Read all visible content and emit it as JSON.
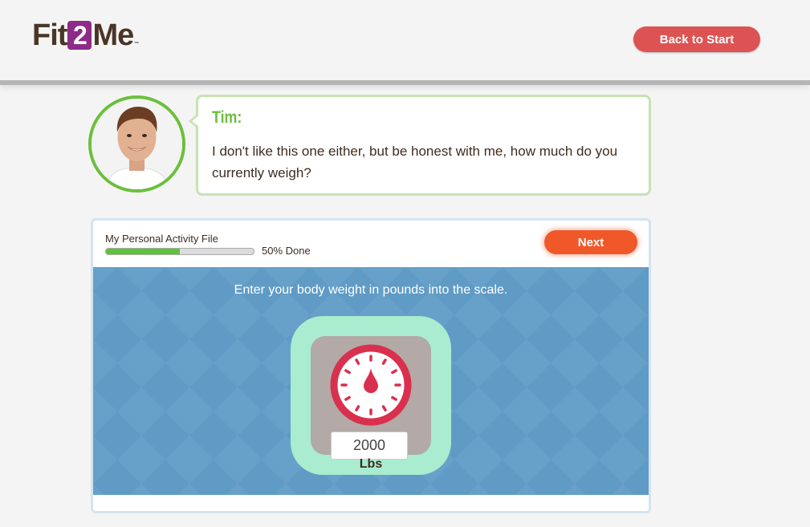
{
  "header": {
    "logo": {
      "part1": "Fit",
      "part2": "2",
      "part3": "Me",
      "tm": "™"
    },
    "back_button": "Back to Start"
  },
  "dialog": {
    "speaker": "Tim:",
    "message": "I don't like this one either, but be honest with me, how much do you currently weigh?"
  },
  "progress": {
    "label": "My Personal Activity File",
    "percent": 50,
    "text": "50% Done"
  },
  "next_button": "Next",
  "scale": {
    "instruction": "Enter your body weight in pounds into the scale.",
    "value": "2000",
    "unit": "Lbs"
  },
  "colors": {
    "brand_purple": "#8e2b88",
    "back_button": "#dd5353",
    "next_button": "#f0582a",
    "progress_fill": "#5ec33a",
    "avatar_ring": "#6bbf3b",
    "stage_blue": "#5f9bc5",
    "scale_mint": "#a9ecd0",
    "dial_red": "#d9304d"
  },
  "icons": [
    "scale-dial-icon",
    "avatar-photo"
  ]
}
